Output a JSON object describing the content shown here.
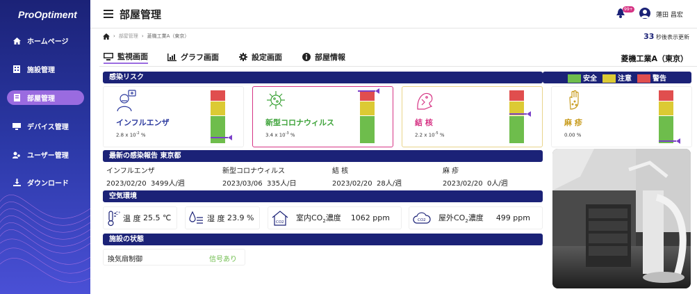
{
  "app": {
    "logo": "ProOptiment"
  },
  "sidebar": {
    "items": [
      {
        "label": "ホームページ",
        "icon": "home-icon"
      },
      {
        "label": "施設管理",
        "icon": "building-icon"
      },
      {
        "label": "部屋管理",
        "icon": "room-icon",
        "active": true
      },
      {
        "label": "デバイス管理",
        "icon": "device-icon"
      },
      {
        "label": "ユーザー管理",
        "icon": "users-icon"
      },
      {
        "label": "ダウンロード",
        "icon": "download-icon"
      }
    ]
  },
  "header": {
    "title": "部屋管理",
    "badge": "99+",
    "user": "蓮田 昌宏"
  },
  "breadcrumb": {
    "level1": "部屋管理",
    "level2": "菱機工業A（東京）"
  },
  "refresh": {
    "seconds": "33",
    "suffix": "秒後表示更新"
  },
  "tabs": [
    {
      "label": "監視画面",
      "icon": "monitor-icon"
    },
    {
      "label": "グラフ画面",
      "icon": "chart-icon"
    },
    {
      "label": "設定画面",
      "icon": "gear-icon"
    },
    {
      "label": "部屋情報",
      "icon": "info-icon"
    }
  ],
  "company": "菱機工業A（東京）",
  "risk": {
    "title": "感染リスク",
    "legend": [
      {
        "label": "安全",
        "color": "#6ebd4c"
      },
      {
        "label": "注意",
        "color": "#dcca34"
      },
      {
        "label": "警告",
        "color": "#e04e4e"
      }
    ],
    "cards": [
      {
        "name": "インフルエンザ",
        "value": "2.8 x 10",
        "exp": "-2",
        "unit": " %",
        "color": "#2c3a9e",
        "level": 0.09
      },
      {
        "name": "新型コロナウィルス",
        "value": "3.4 x 10",
        "exp": "-3",
        "unit": " %",
        "color": "#3ea33a",
        "level": 1.0
      },
      {
        "name": "結 核",
        "value": "2.2 x 10",
        "exp": "-5",
        "unit": " %",
        "color": "#d63384",
        "level": 0.55
      },
      {
        "name": "麻 疹",
        "value": "0.00 %",
        "exp": "",
        "unit": "",
        "color": "#c79a1a",
        "level": 0.03
      }
    ]
  },
  "report": {
    "title": "最新の感染報告 東京都",
    "items": [
      {
        "disease": "インフルエンザ",
        "date": "2023/02/20",
        "count": "3499人/週"
      },
      {
        "disease": "新型コロナウィルス",
        "date": "2023/03/06",
        "count": "335人/日"
      },
      {
        "disease": "結 核",
        "date": "2023/02/20",
        "count": "28人/週"
      },
      {
        "disease": "麻 疹",
        "date": "2023/02/20",
        "count": "0人/週"
      }
    ]
  },
  "env": {
    "title": "空気環境",
    "temp_label": "温 度",
    "temp_value": "25.5 ℃",
    "hum_label": "湿 度",
    "hum_value": "23.9 %",
    "indoor_pre": "室内CO",
    "indoor_post": "濃度",
    "indoor_value": "1062 ppm",
    "outdoor_pre": "屋外CO",
    "outdoor_post": "濃度",
    "outdoor_value": "499 ppm",
    "sub": "2",
    "co2_tag": "CO2"
  },
  "facility": {
    "title": "施設の状態",
    "label": "換気扇制御",
    "status": "信号あり"
  }
}
